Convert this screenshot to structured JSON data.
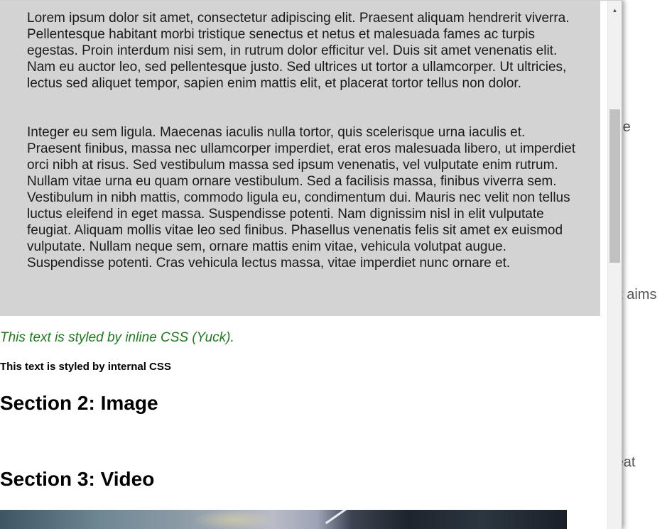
{
  "background_page": {
    "fragments": [
      " the",
      "at aims",
      "reat"
    ]
  },
  "popup": {
    "paragraphs": [
      "Lorem ipsum dolor sit amet, consectetur adipiscing elit. Praesent aliquam hendrerit viverra. Pellentesque habitant morbi tristique senectus et netus et malesuada fames ac turpis egestas. Proin interdum nisi sem, in rutrum dolor efficitur vel. Duis sit amet venenatis elit. Nam eu auctor leo, sed pellentesque justo. Sed ultrices ut tortor a ullamcorper. Ut ultricies, lectus sed aliquet tempor, sapien enim mattis elit, et placerat tortor tellus non dolor.",
      "Integer eu sem ligula. Maecenas iaculis nulla tortor, quis scelerisque urna iaculis et. Praesent finibus, massa nec ullamcorper imperdiet, erat eros malesuada libero, ut imperdiet orci nibh at risus. Sed vestibulum massa sed ipsum venenatis, vel vulputate enim rutrum. Nullam vitae urna eu quam ornare vestibulum. Sed a facilisis massa, finibus viverra sem. Vestibulum in nibh mattis, commodo ligula eu, condimentum dui. Mauris nec velit non tellus luctus eleifend in eget massa. Suspendisse potenti. Nam dignissim nisl in elit vulputate feugiat. Aliquam mollis vitae leo sed finibus. Phasellus venenatis felis sit amet ex euismod vulputate. Nullam neque sem, ornare mattis enim vitae, vehicula volutpat augue. Suspendisse potenti. Cras vehicula lectus massa, vitae imperdiet nunc ornare et."
    ],
    "inline_css_text": "This text is styled by inline CSS (Yuck).",
    "internal_css_text": "This text is styled by internal CSS",
    "section2_heading": "Section 2: Image",
    "section3_heading": "Section 3: Video"
  },
  "scrollbar": {
    "up_arrow_icon": "triangle-up",
    "thumb_color": "#c1c1c1"
  },
  "colors": {
    "grey_box": "#d3d3d3",
    "inline_text": "#1f7a1f",
    "fragment_text": "#555555"
  }
}
